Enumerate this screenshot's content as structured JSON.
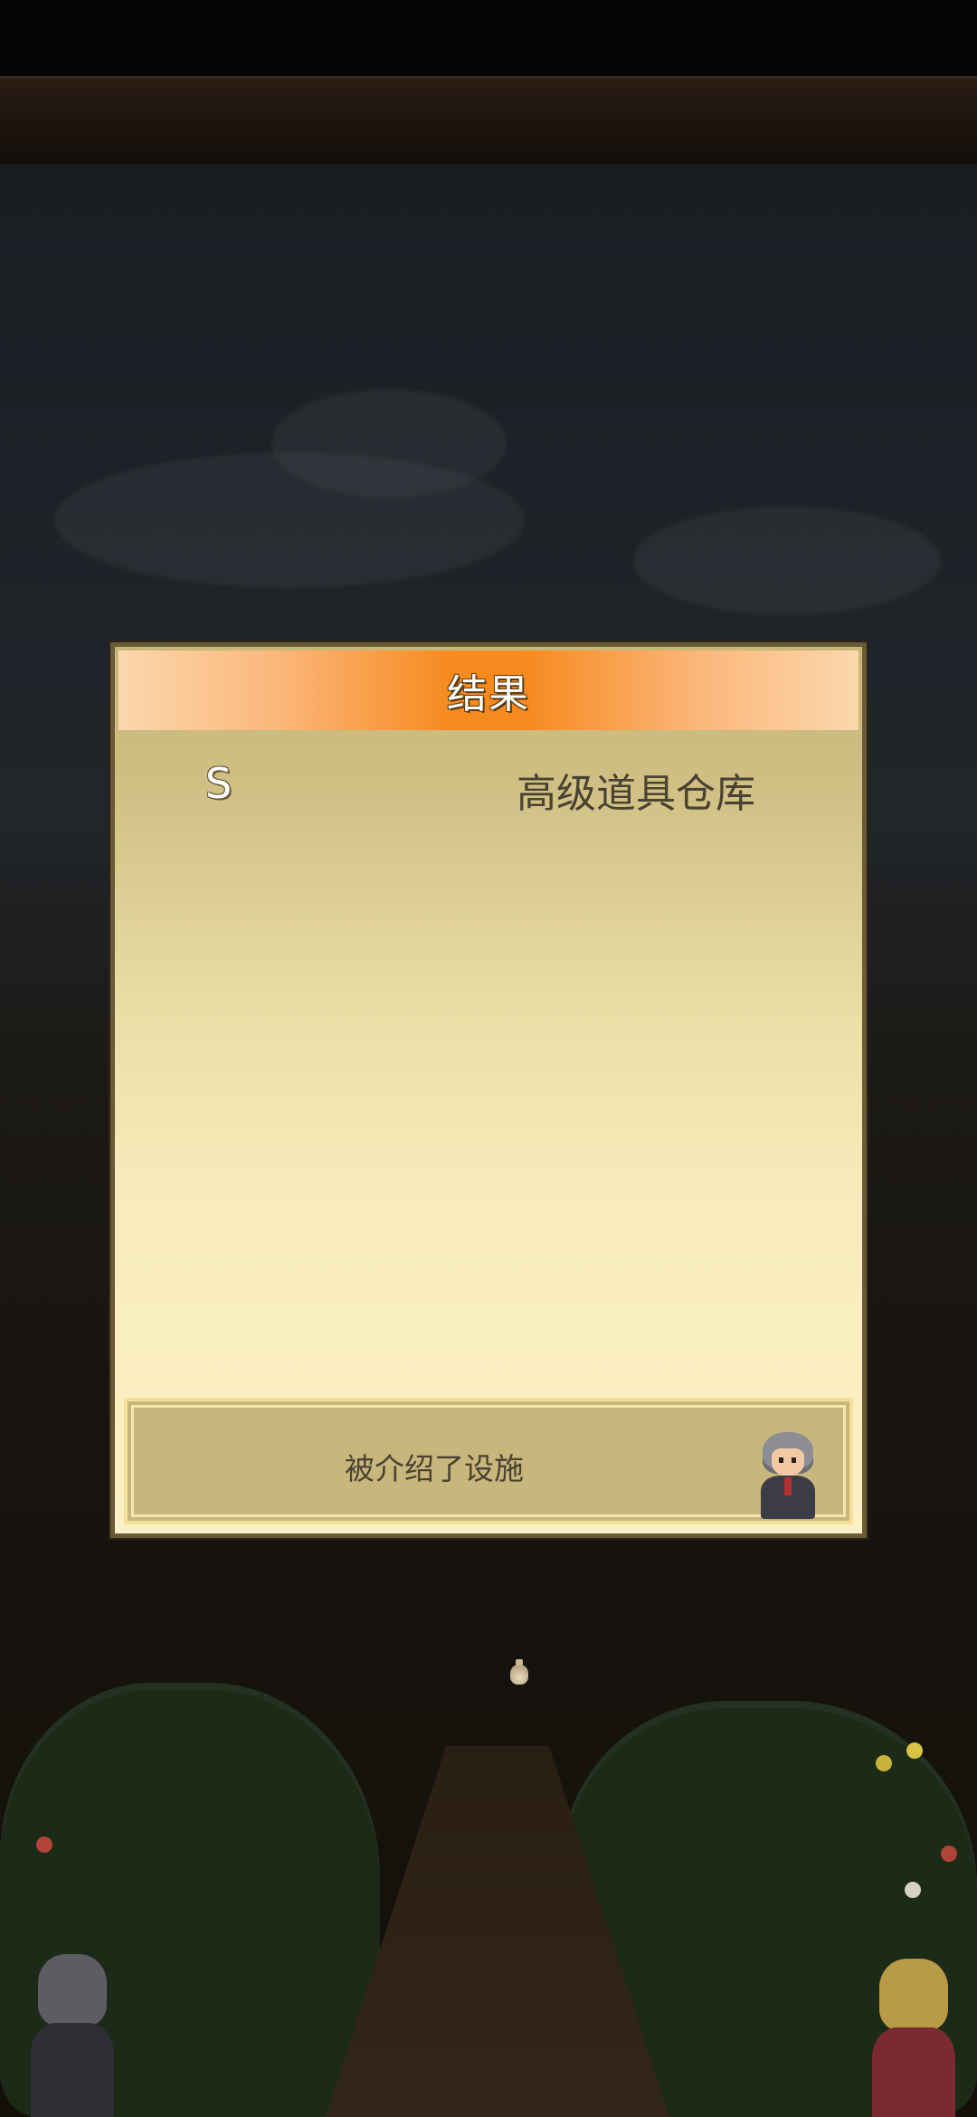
{
  "dialog": {
    "title": "结果",
    "result": {
      "grade": "S",
      "item_name": "高级道具仓库"
    },
    "message": "被介绍了设施",
    "speaker_icon": "elderly-man-portrait"
  },
  "colors": {
    "header_orange": "#f78a1f",
    "panel_gold": "#c8b77c",
    "panel_cream": "#fbf1c6",
    "frame_brown": "#6b5a38"
  },
  "scene": {
    "background": "night-town-road",
    "center_item_icon": "money-sack-icon"
  }
}
